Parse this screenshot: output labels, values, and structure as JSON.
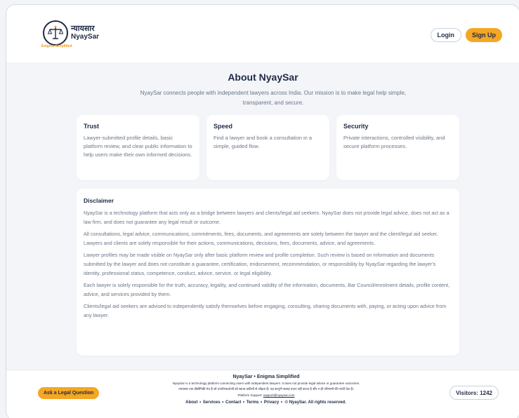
{
  "header": {
    "logo_hindi": "न्यायसार",
    "logo_english": "NyaySar",
    "logo_tagline": "Enigma Simplified",
    "login_label": "Login",
    "signup_label": "Sign Up"
  },
  "about": {
    "title": "About NyaySar",
    "subtitle": "NyaySar connects people with independent lawyers across India. Our mission is to make legal help simple, transparent, and secure."
  },
  "cards": [
    {
      "title": "Trust",
      "text": "Lawyer-submitted profile details, basic platform review, and clear public information to help users make their own informed decisions."
    },
    {
      "title": "Speed",
      "text": "Find a lawyer and book a consultation in a simple, guided flow."
    },
    {
      "title": "Security",
      "text": "Private interactions, controlled visibility, and secure platform processes."
    }
  ],
  "disclaimer": {
    "title": "Disclaimer",
    "paragraphs": [
      "NyaySar is a technology platform that acts only as a bridge between lawyers and clients/legal aid seekers. NyaySar does not provide legal advice, does not act as a law firm, and does not guarantee any legal result or outcome.",
      "All consultations, legal advice, communications, commitments, fees, documents, and agreements are solely between the lawyer and the client/legal aid seeker. Lawyers and clients are solely responsible for their actions, communications, decisions, fees, documents, advice, and agreements.",
      "Lawyer profiles may be made visible on NyaySar only after basic platform review and profile completion. Such review is based on information and documents submitted by the lawyer and does not constitute a guarantee, certification, endorsement, recommendation, or responsibility by NyaySar regarding the lawyer's identity, professional status, competence, conduct, advice, service, or legal eligibility.",
      "Each lawyer is solely responsible for the truth, accuracy, legality, and continued validity of the information, documents, Bar Council/enrolment details, profile content, advice, and services provided by them.",
      "Clients/legal aid seekers are advised to independently satisfy themselves before engaging, consulting, sharing documents with, paying, or acting upon advice from any lawyer."
    ]
  },
  "footer": {
    "ask_label": "Ask a Legal Question",
    "brand": "NyaySar • Enigma Simplified",
    "line_en": "NyaySar is a technology platform connecting users with independent lawyers. It does not provide legal advice or guarantee outcomes.",
    "line_hi": "न्यायसार एक प्रौद्योगिकी मंच है जो उपयोगकर्ताओं को स्वतंत्र वकीलों से जोड़ता है। यह कानूनी सलाह प्रदान नहीं करता है और न ही परिणामों की गारंटी देता है।",
    "support_label": "Platform Support:",
    "support_email": "support@nyaysar.com",
    "links": [
      "About",
      "Services",
      "Contact",
      "Terms",
      "Privacy"
    ],
    "copyright": "© NyaySar. All rights reserved.",
    "visitors_label": "Visitors: 1242"
  },
  "colors": {
    "accent": "#f5a623",
    "navy": "#1f2a44",
    "muted": "#6b7688"
  }
}
